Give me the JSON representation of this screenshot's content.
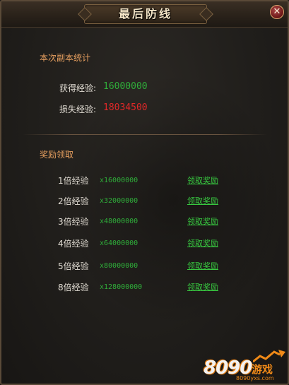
{
  "window": {
    "title": "最后防线",
    "close_symbol": "✕"
  },
  "stats": {
    "section_title": "本次副本统计",
    "gained_label": "获得经验:",
    "gained_value": "16000000",
    "lost_label": "损失经验:",
    "lost_value": "18034500"
  },
  "rewards": {
    "section_title": "奖励领取",
    "items": [
      {
        "label": "1倍经验",
        "amount": "x16000000",
        "action": "领取奖励"
      },
      {
        "label": "2倍经验",
        "amount": "x32000000",
        "action": "领取奖励"
      },
      {
        "label": "3倍经验",
        "amount": "x48000000",
        "action": "领取奖励"
      },
      {
        "label": "4倍经验",
        "amount": "x64000000",
        "action": "领取奖励"
      },
      {
        "label": "5倍经验",
        "amount": "x80000000",
        "action": "领取奖励"
      },
      {
        "label": "8倍经验",
        "amount": "x128000000",
        "action": "领取奖励"
      }
    ]
  },
  "watermark": {
    "digits": "8090",
    "text": "游戏",
    "url": "8090yxs.com"
  },
  "colors": {
    "section_title": "#e8a060",
    "gained_value": "#2fae3a",
    "lost_value": "#e02828",
    "claim_link": "#38c840"
  }
}
